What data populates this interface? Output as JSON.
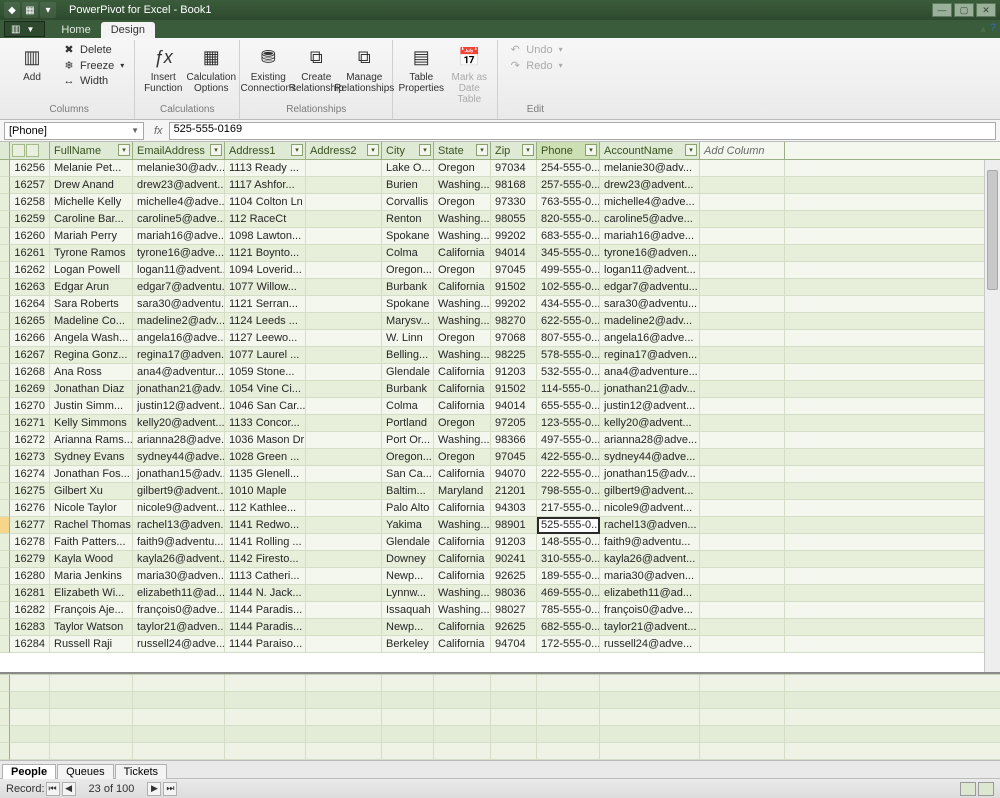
{
  "titlebar": {
    "title": "PowerPivot for Excel - Book1"
  },
  "tabs": {
    "home": "Home",
    "design": "Design"
  },
  "ribbon": {
    "add": "Add",
    "delete": "Delete",
    "freeze": "Freeze",
    "width": "Width",
    "columns_group": "Columns",
    "insert_function": "Insert\nFunction",
    "calc_options": "Calculation\nOptions",
    "calculations_group": "Calculations",
    "existing_conn": "Existing\nConnections",
    "create_rel": "Create\nRelationship",
    "manage_rel": "Manage\nRelationships",
    "relationships_group": "Relationships",
    "table_props": "Table\nProperties",
    "mark_date": "Mark as\nDate Table",
    "undo": "Undo",
    "redo": "Redo",
    "edit_group": "Edit"
  },
  "formula": {
    "namebox": "[Phone]",
    "value": "525-555-0169"
  },
  "columns": {
    "fullname": "FullName",
    "email": "EmailAddress",
    "addr1": "Address1",
    "addr2": "Address2",
    "city": "City",
    "state": "State",
    "zip": "Zip",
    "phone": "Phone",
    "acct": "AccountName",
    "add": "Add Column"
  },
  "rows": [
    {
      "id": "16256",
      "fn": "Melanie Pet...",
      "em": "melanie30@adv...",
      "a1": "1113 Ready ...",
      "a2": "",
      "ci": "Lake O...",
      "st": "Oregon",
      "zp": "97034",
      "ph": "254-555-0...",
      "ac": "melanie30@adv..."
    },
    {
      "id": "16257",
      "fn": "Drew Anand",
      "em": "drew23@advent...",
      "a1": "1117 Ashfor...",
      "a2": "",
      "ci": "Burien",
      "st": "Washing...",
      "zp": "98168",
      "ph": "257-555-0...",
      "ac": "drew23@advent..."
    },
    {
      "id": "16258",
      "fn": "Michelle Kelly",
      "em": "michelle4@adve...",
      "a1": "1104 Colton Ln",
      "a2": "",
      "ci": "Corvallis",
      "st": "Oregon",
      "zp": "97330",
      "ph": "763-555-0...",
      "ac": "michelle4@adve..."
    },
    {
      "id": "16259",
      "fn": "Caroline Bar...",
      "em": "caroline5@adve...",
      "a1": "112 RaceCt",
      "a2": "",
      "ci": "Renton",
      "st": "Washing...",
      "zp": "98055",
      "ph": "820-555-0...",
      "ac": "caroline5@adve..."
    },
    {
      "id": "16260",
      "fn": "Mariah Perry",
      "em": "mariah16@adve...",
      "a1": "1098 Lawton...",
      "a2": "",
      "ci": "Spokane",
      "st": "Washing...",
      "zp": "99202",
      "ph": "683-555-0...",
      "ac": "mariah16@adve..."
    },
    {
      "id": "16261",
      "fn": "Tyrone Ramos",
      "em": "tyrone16@adve...",
      "a1": "1121 Boynto...",
      "a2": "",
      "ci": "Colma",
      "st": "California",
      "zp": "94014",
      "ph": "345-555-0...",
      "ac": "tyrone16@adven..."
    },
    {
      "id": "16262",
      "fn": "Logan Powell",
      "em": "logan11@advent...",
      "a1": "1094 Loverid...",
      "a2": "",
      "ci": "Oregon...",
      "st": "Oregon",
      "zp": "97045",
      "ph": "499-555-0...",
      "ac": "logan11@advent..."
    },
    {
      "id": "16263",
      "fn": "Edgar Arun",
      "em": "edgar7@adventu...",
      "a1": "1077 Willow...",
      "a2": "",
      "ci": "Burbank",
      "st": "California",
      "zp": "91502",
      "ph": "102-555-0...",
      "ac": "edgar7@adventu..."
    },
    {
      "id": "16264",
      "fn": "Sara Roberts",
      "em": "sara30@adventu...",
      "a1": "1121 Serran...",
      "a2": "",
      "ci": "Spokane",
      "st": "Washing...",
      "zp": "99202",
      "ph": "434-555-0...",
      "ac": "sara30@adventu..."
    },
    {
      "id": "16265",
      "fn": "Madeline Co...",
      "em": "madeline2@adv...",
      "a1": "1124 Leeds ...",
      "a2": "",
      "ci": "Marysv...",
      "st": "Washing...",
      "zp": "98270",
      "ph": "622-555-0...",
      "ac": "madeline2@adv..."
    },
    {
      "id": "16266",
      "fn": "Angela Wash...",
      "em": "angela16@adve...",
      "a1": "1127 Leewo...",
      "a2": "",
      "ci": "W. Linn",
      "st": "Oregon",
      "zp": "97068",
      "ph": "807-555-0...",
      "ac": "angela16@adve..."
    },
    {
      "id": "16267",
      "fn": "Regina Gonz...",
      "em": "regina17@adven...",
      "a1": "1077 Laurel ...",
      "a2": "",
      "ci": "Belling...",
      "st": "Washing...",
      "zp": "98225",
      "ph": "578-555-0...",
      "ac": "regina17@adven..."
    },
    {
      "id": "16268",
      "fn": "Ana Ross",
      "em": "ana4@adventur...",
      "a1": "1059 Stone...",
      "a2": "",
      "ci": "Glendale",
      "st": "California",
      "zp": "91203",
      "ph": "532-555-0...",
      "ac": "ana4@adventure..."
    },
    {
      "id": "16269",
      "fn": "Jonathan Diaz",
      "em": "jonathan21@adv...",
      "a1": "1054 Vine Ci...",
      "a2": "",
      "ci": "Burbank",
      "st": "California",
      "zp": "91502",
      "ph": "114-555-0...",
      "ac": "jonathan21@adv..."
    },
    {
      "id": "16270",
      "fn": "Justin Simm...",
      "em": "justin12@advent...",
      "a1": "1046 San Car...",
      "a2": "",
      "ci": "Colma",
      "st": "California",
      "zp": "94014",
      "ph": "655-555-0...",
      "ac": "justin12@advent..."
    },
    {
      "id": "16271",
      "fn": "Kelly Simmons",
      "em": "kelly20@advent...",
      "a1": "1133 Concor...",
      "a2": "",
      "ci": "Portland",
      "st": "Oregon",
      "zp": "97205",
      "ph": "123-555-0...",
      "ac": "kelly20@advent..."
    },
    {
      "id": "16272",
      "fn": "Arianna Rams...",
      "em": "arianna28@adve...",
      "a1": "1036 Mason Dr",
      "a2": "",
      "ci": "Port Or...",
      "st": "Washing...",
      "zp": "98366",
      "ph": "497-555-0...",
      "ac": "arianna28@adve..."
    },
    {
      "id": "16273",
      "fn": "Sydney Evans",
      "em": "sydney44@adve...",
      "a1": "1028 Green ...",
      "a2": "",
      "ci": "Oregon...",
      "st": "Oregon",
      "zp": "97045",
      "ph": "422-555-0...",
      "ac": "sydney44@adve..."
    },
    {
      "id": "16274",
      "fn": "Jonathan Fos...",
      "em": "jonathan15@adv...",
      "a1": "1135 Glenell...",
      "a2": "",
      "ci": "San Ca...",
      "st": "California",
      "zp": "94070",
      "ph": "222-555-0...",
      "ac": "jonathan15@adv..."
    },
    {
      "id": "16275",
      "fn": "Gilbert Xu",
      "em": "gilbert9@advent...",
      "a1": "1010 Maple",
      "a2": "",
      "ci": "Baltim...",
      "st": "Maryland",
      "zp": "21201",
      "ph": "798-555-0...",
      "ac": "gilbert9@advent..."
    },
    {
      "id": "16276",
      "fn": "Nicole Taylor",
      "em": "nicole9@advent...",
      "a1": "112 Kathlee...",
      "a2": "",
      "ci": "Palo Alto",
      "st": "California",
      "zp": "94303",
      "ph": "217-555-0...",
      "ac": "nicole9@advent..."
    },
    {
      "id": "16277",
      "fn": "Rachel Thomas",
      "em": "rachel13@adven...",
      "a1": "1141 Redwo...",
      "a2": "",
      "ci": "Yakima",
      "st": "Washing...",
      "zp": "98901",
      "ph": "525-555-0...",
      "ac": "rachel13@adven..."
    },
    {
      "id": "16278",
      "fn": "Faith Patters...",
      "em": "faith9@adventu...",
      "a1": "1141 Rolling ...",
      "a2": "",
      "ci": "Glendale",
      "st": "California",
      "zp": "91203",
      "ph": "148-555-0...",
      "ac": "faith9@adventu..."
    },
    {
      "id": "16279",
      "fn": "Kayla Wood",
      "em": "kayla26@advent...",
      "a1": "1142 Firesto...",
      "a2": "",
      "ci": "Downey",
      "st": "California",
      "zp": "90241",
      "ph": "310-555-0...",
      "ac": "kayla26@advent..."
    },
    {
      "id": "16280",
      "fn": "Maria Jenkins",
      "em": "maria30@adven...",
      "a1": "1113 Catheri...",
      "a2": "",
      "ci": "Newp...",
      "st": "California",
      "zp": "92625",
      "ph": "189-555-0...",
      "ac": "maria30@adven..."
    },
    {
      "id": "16281",
      "fn": "Elizabeth Wi...",
      "em": "elizabeth11@ad...",
      "a1": "1144 N. Jack...",
      "a2": "",
      "ci": "Lynnw...",
      "st": "Washing...",
      "zp": "98036",
      "ph": "469-555-0...",
      "ac": "elizabeth11@ad..."
    },
    {
      "id": "16282",
      "fn": "François Aje...",
      "em": "françois0@adve...",
      "a1": "1144 Paradis...",
      "a2": "",
      "ci": "Issaquah",
      "st": "Washing...",
      "zp": "98027",
      "ph": "785-555-0...",
      "ac": "françois0@adve..."
    },
    {
      "id": "16283",
      "fn": "Taylor Watson",
      "em": "taylor21@adven...",
      "a1": "1144 Paradis...",
      "a2": "",
      "ci": "Newp...",
      "st": "California",
      "zp": "92625",
      "ph": "682-555-0...",
      "ac": "taylor21@advent..."
    },
    {
      "id": "16284",
      "fn": "Russell Raji",
      "em": "russell24@adve...",
      "a1": "1144 Paraiso...",
      "a2": "",
      "ci": "Berkeley",
      "st": "California",
      "zp": "94704",
      "ph": "172-555-0...",
      "ac": "russell24@adve..."
    }
  ],
  "sheets": {
    "people": "People",
    "queues": "Queues",
    "tickets": "Tickets"
  },
  "status": {
    "record": "Record:",
    "pos": "23 of 100"
  },
  "selected": {
    "row_index": 21,
    "col": "ph"
  }
}
